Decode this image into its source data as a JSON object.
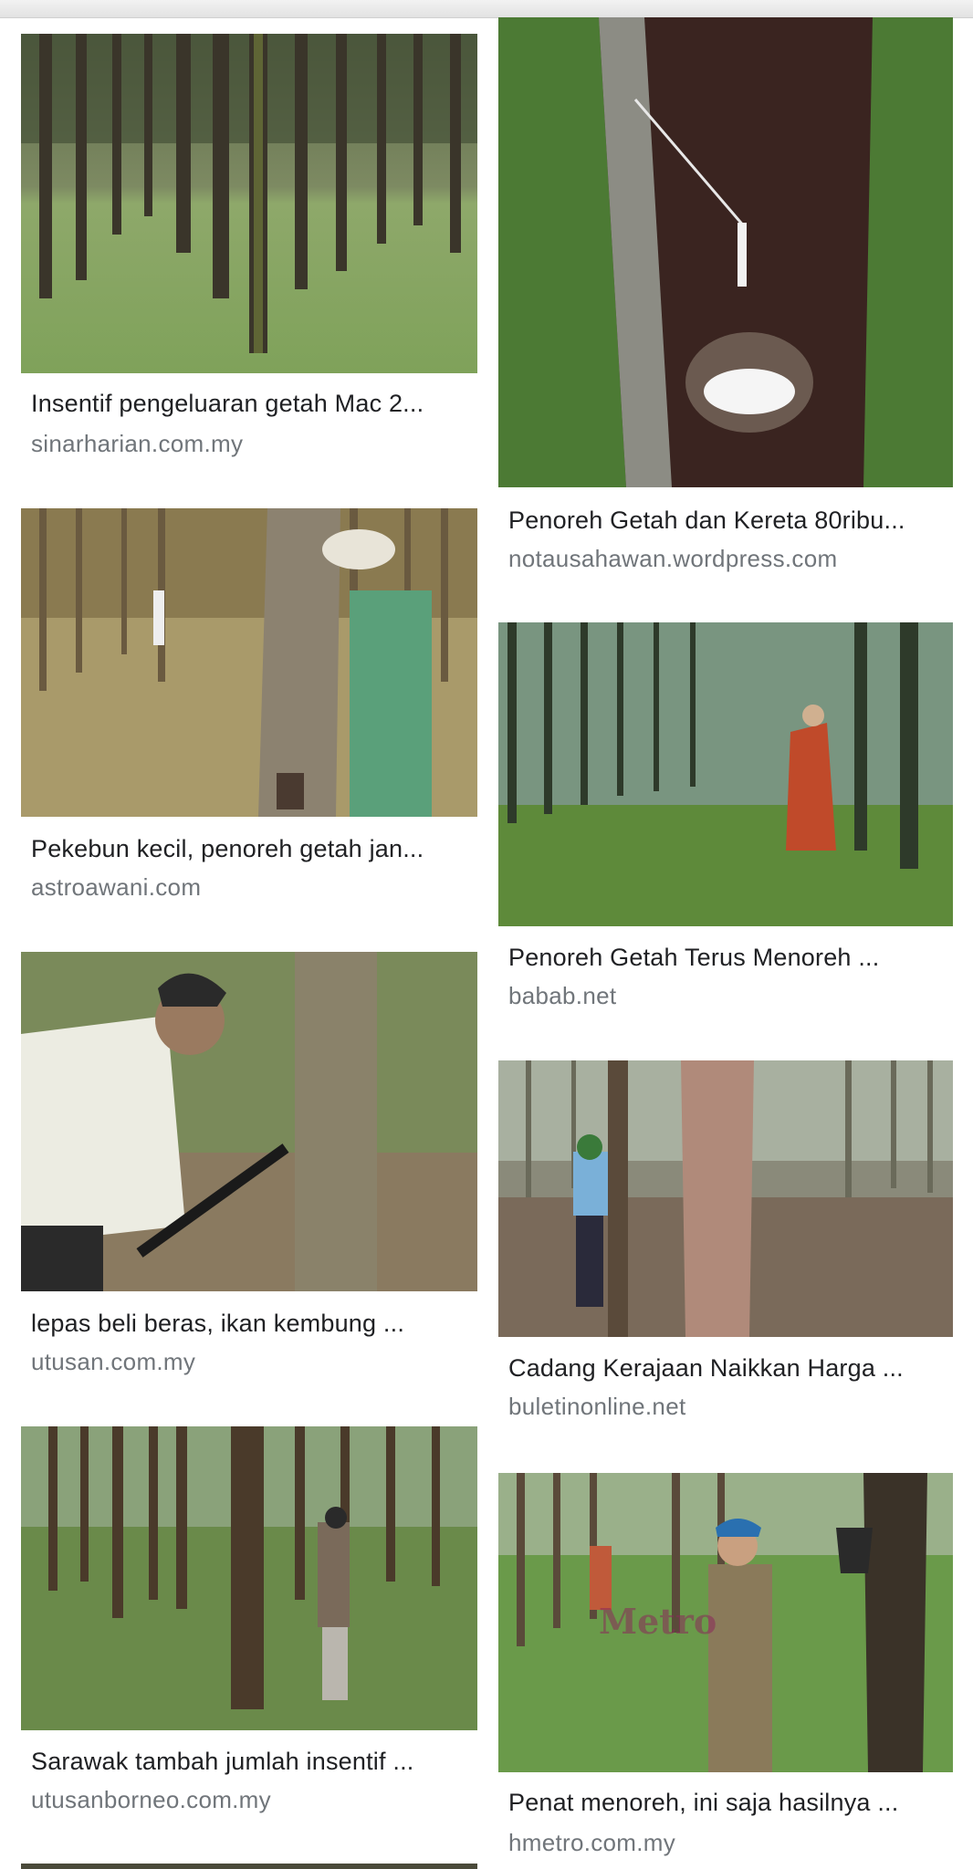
{
  "results": [
    {
      "title": "Insentif pengeluaran getah Mac 2...",
      "source": "sinarharian.com.my"
    },
    {
      "title": "Penoreh Getah dan Kereta 80ribu...",
      "source": "notausahawan.wordpress.com"
    },
    {
      "title": "Pekebun kecil, penoreh getah jan...",
      "source": "astroawani.com"
    },
    {
      "title": "Penoreh Getah Terus Menoreh ...",
      "source": "babab.net"
    },
    {
      "title": "lepas beli beras, ikan kembung ...",
      "source": "utusan.com.my"
    },
    {
      "title": "Cadang Kerajaan Naikkan Harga ...",
      "source": "buletinonline.net"
    },
    {
      "title": "Sarawak tambah jumlah insentif ...",
      "source": "utusanborneo.com.my"
    },
    {
      "title": "Penat menoreh, ini saja hasilnya ...",
      "source": "hmetro.com.my"
    }
  ],
  "watermark_text": "Metro",
  "colors": {
    "title": "#202124",
    "source": "#70757a"
  }
}
